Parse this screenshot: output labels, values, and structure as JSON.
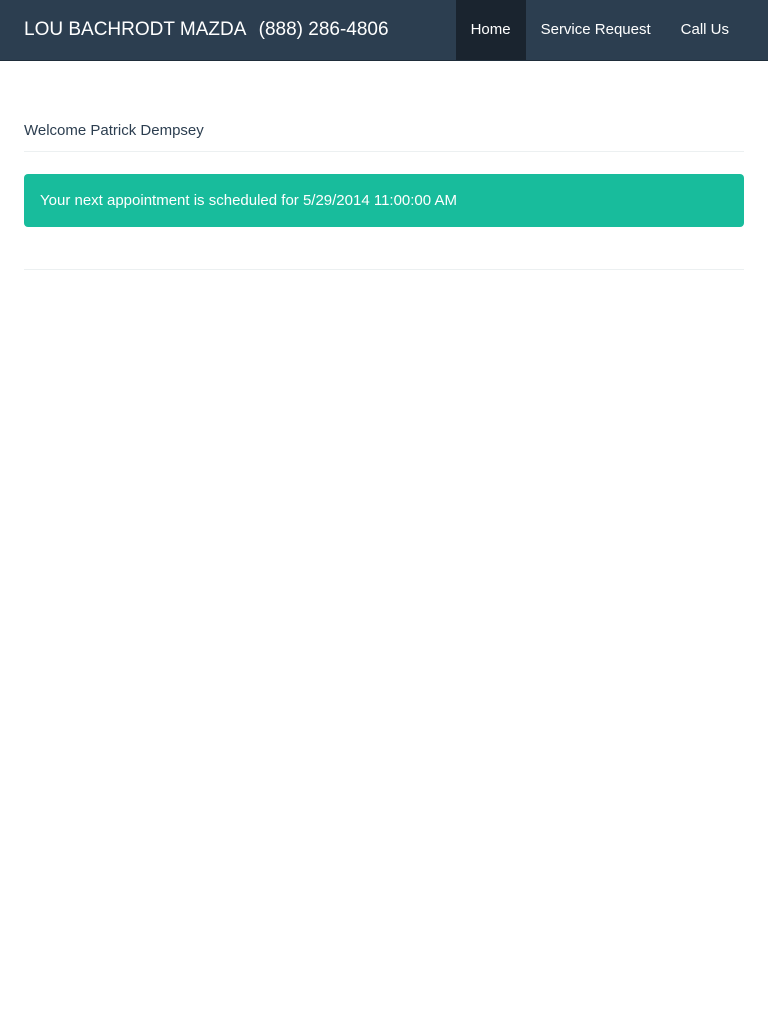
{
  "header": {
    "brand_name": "LOU BACHRODT MAZDA",
    "brand_phone": "(888) 286-4806",
    "nav": [
      {
        "label": "Home",
        "active": true
      },
      {
        "label": "Service Request",
        "active": false
      },
      {
        "label": "Call Us",
        "active": false
      }
    ]
  },
  "main": {
    "welcome_text": "Welcome Patrick Dempsey",
    "alert_text": "Your next appointment is scheduled for 5/29/2014 11:00:00 AM"
  },
  "colors": {
    "navbar": "#2c3e50",
    "nav_active": "#1a242f",
    "alert": "#18bc9c",
    "text": "#2c3e50"
  }
}
